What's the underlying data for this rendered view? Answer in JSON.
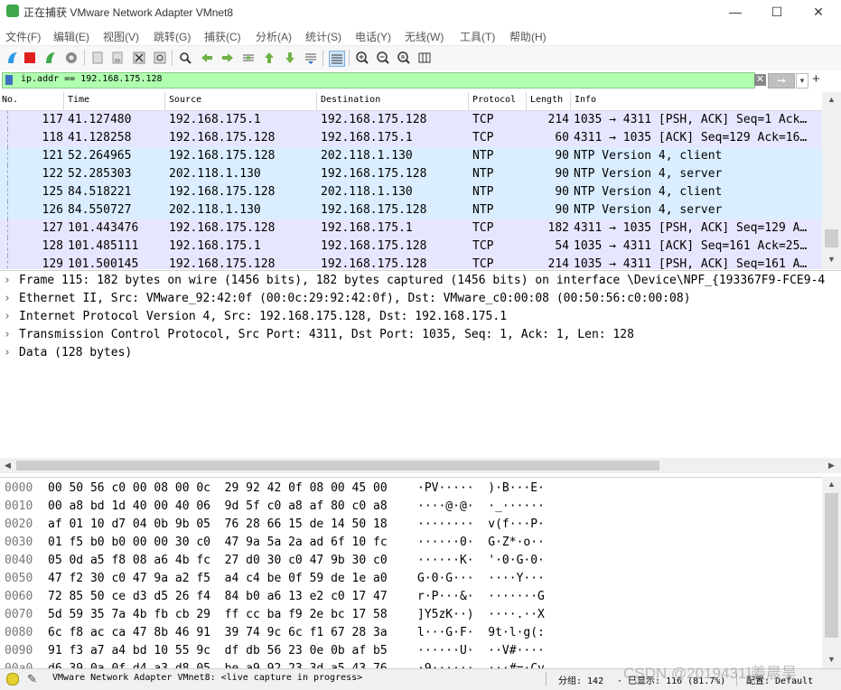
{
  "window": {
    "title": "正在捕获 VMware Network Adapter VMnet8",
    "minimize": "—",
    "maximize": "☐",
    "close": "✕"
  },
  "menu": [
    "文件(F)",
    "编辑(E)",
    "视图(V)",
    "跳转(G)",
    "捕获(C)",
    "分析(A)",
    "统计(S)",
    "电话(Y)",
    "无线(W)",
    "工具(T)",
    "帮助(H)"
  ],
  "filter": {
    "value": "ip.addr == 192.168.175.128"
  },
  "packet_list": {
    "columns": [
      "No.",
      "Time",
      "Source",
      "Destination",
      "Protocol",
      "Length",
      "Info"
    ],
    "rows": [
      {
        "no": "117",
        "time": "41.127480",
        "src": "192.168.175.1",
        "dst": "192.168.175.128",
        "proto": "TCP",
        "len": "214",
        "info": "1035 → 4311 [PSH, ACK] Seq=1 Ack…",
        "kind": "tcp"
      },
      {
        "no": "118",
        "time": "41.128258",
        "src": "192.168.175.128",
        "dst": "192.168.175.1",
        "proto": "TCP",
        "len": "60",
        "info": "4311 → 1035 [ACK] Seq=129 Ack=16…",
        "kind": "tcp"
      },
      {
        "no": "121",
        "time": "52.264965",
        "src": "192.168.175.128",
        "dst": "202.118.1.130",
        "proto": "NTP",
        "len": "90",
        "info": "NTP Version 4, client",
        "kind": "udp"
      },
      {
        "no": "122",
        "time": "52.285303",
        "src": "202.118.1.130",
        "dst": "192.168.175.128",
        "proto": "NTP",
        "len": "90",
        "info": "NTP Version 4, server",
        "kind": "udp"
      },
      {
        "no": "125",
        "time": "84.518221",
        "src": "192.168.175.128",
        "dst": "202.118.1.130",
        "proto": "NTP",
        "len": "90",
        "info": "NTP Version 4, client",
        "kind": "udp"
      },
      {
        "no": "126",
        "time": "84.550727",
        "src": "202.118.1.130",
        "dst": "192.168.175.128",
        "proto": "NTP",
        "len": "90",
        "info": "NTP Version 4, server",
        "kind": "udp"
      },
      {
        "no": "127",
        "time": "101.443476",
        "src": "192.168.175.128",
        "dst": "192.168.175.1",
        "proto": "TCP",
        "len": "182",
        "info": "4311 → 1035 [PSH, ACK] Seq=129 A…",
        "kind": "tcp"
      },
      {
        "no": "128",
        "time": "101.485111",
        "src": "192.168.175.1",
        "dst": "192.168.175.128",
        "proto": "TCP",
        "len": "54",
        "info": "1035 → 4311 [ACK] Seq=161 Ack=25…",
        "kind": "tcp"
      },
      {
        "no": "129",
        "time": "101.500145",
        "src": "192.168.175.128",
        "dst": "192.168.175.128",
        "proto": "TCP",
        "len": "214",
        "info": "1035 → 4311 [PSH, ACK] Seq=161 A…",
        "kind": "tcp"
      }
    ]
  },
  "details": [
    "Frame 115: 182 bytes on wire (1456 bits), 182 bytes captured (1456 bits) on interface \\Device\\NPF_{193367F9-FCE9-4",
    "Ethernet II, Src: VMware_92:42:0f (00:0c:29:92:42:0f), Dst: VMware_c0:00:08 (00:50:56:c0:00:08)",
    "Internet Protocol Version 4, Src: 192.168.175.128, Dst: 192.168.175.1",
    "Transmission Control Protocol, Src Port: 4311, Dst Port: 1035, Seq: 1, Ack: 1, Len: 128",
    "Data (128 bytes)"
  ],
  "bytes": [
    {
      "off": "0000",
      "hex": "00 50 56 c0 00 08 00 0c  29 92 42 0f 08 00 45 00",
      "asc": "·PV·····  )·B···E·"
    },
    {
      "off": "0010",
      "hex": "00 a8 bd 1d 40 00 40 06  9d 5f c0 a8 af 80 c0 a8",
      "asc": "····@·@·  ·_······"
    },
    {
      "off": "0020",
      "hex": "af 01 10 d7 04 0b 9b 05  76 28 66 15 de 14 50 18",
      "asc": "········  v(f···P·"
    },
    {
      "off": "0030",
      "hex": "01 f5 b0 b0 00 00 30 c0  47 9a 5a 2a ad 6f 10 fc",
      "asc": "······0·  G·Z*·o··"
    },
    {
      "off": "0040",
      "hex": "05 0d a5 f8 08 a6 4b fc  27 d0 30 c0 47 9b 30 c0",
      "asc": "······K·  '·0·G·0·"
    },
    {
      "off": "0050",
      "hex": "47 f2 30 c0 47 9a a2 f5  a4 c4 be 0f 59 de 1e a0",
      "asc": "G·0·G···  ····Y···"
    },
    {
      "off": "0060",
      "hex": "72 85 50 ce d3 d5 26 f4  84 b0 a6 13 e2 c0 17 47",
      "asc": "r·P···&·  ·······G"
    },
    {
      "off": "0070",
      "hex": "5d 59 35 7a 4b fb cb 29  ff cc ba f9 2e bc 17 58",
      "asc": "]Y5zK··)  ····.··X"
    },
    {
      "off": "0080",
      "hex": "6c f8 ac ca 47 8b 46 91  39 74 9c 6c f1 67 28 3a",
      "asc": "l···G·F·  9t·l·g(:"
    },
    {
      "off": "0090",
      "hex": "91 f3 a7 a4 bd 10 55 9c  df db 56 23 0e 0b af b5",
      "asc": "······U·  ··V#····"
    },
    {
      "off": "00a0",
      "hex": "d6 39 0a 0f d4 a3 d8 05  be a9 92 23 3d a5 43 76",
      "asc": "·9······  ···#=·Cv"
    }
  ],
  "status": {
    "capture": "VMware Network Adapter VMnet8: <live capture in progress>",
    "packets": "分组: 142",
    "displayed": "· 已显示: 116 (81.7%)",
    "profile": "配置: Default"
  },
  "watermark": "CSDN @2019431]姜晨昊",
  "colors": {
    "tcp_row": "#e7e6ff",
    "udp_row": "#daeeff",
    "filter_ok": "#afffaf"
  }
}
